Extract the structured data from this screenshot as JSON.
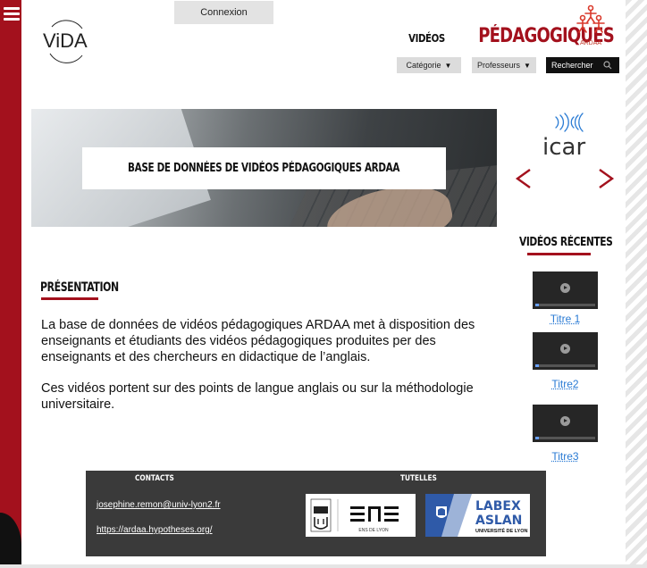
{
  "header": {
    "connexion_label": "Connexion",
    "title_small": "VIDÉOS",
    "title_big": "PÉDAGOGIQUES",
    "vida_logo_text": "ViDA",
    "ardaa_logo_text": "ARDAA"
  },
  "filters": {
    "categorie_label": "Catégorie",
    "professeurs_label": "Professeurs",
    "search_label": "Rechercher"
  },
  "banner": {
    "title": "BASE DE DONNÉES DE VIDÉOS PÉDAGOGIQUES ARDAA"
  },
  "partner": {
    "icar_text": "icar"
  },
  "recent": {
    "heading": "VIDÉOS RÉCENTES",
    "videos": [
      {
        "title": "Titre 1"
      },
      {
        "title": "Titre2"
      },
      {
        "title": "Titre3"
      }
    ]
  },
  "presentation": {
    "heading": "PRÉSENTATION",
    "paragraph1": "La base de données de vidéos pédagogiques ARDAA met à disposition des enseignants et étudiants des vidéos pédagogiques produites per des enseignants et des chercheurs en didactique de l’anglais.",
    "paragraph2": "Ces vidéos portent sur des points de langue anglais ou sur la méthodologie universitaire."
  },
  "footer": {
    "contacts_heading": "CONTACTS",
    "tutelles_heading": "TUTELLES",
    "email": "josephine.remon@univ-lyon2.fr",
    "blog_url": "https://ardaa.hypotheses.org/",
    "ens_caption": "ENS DE LYON",
    "lyon_caption": "UNIVERSITÉ DE LYON",
    "labex_line1": "LABEX",
    "labex_line2": "ASLAN",
    "labex_line3": "UNIVERSITÉ DE LYON"
  },
  "colors": {
    "brand_red": "#a3111d",
    "link_blue": "#2a7bd4",
    "footer_bg": "#3a3a3a"
  }
}
